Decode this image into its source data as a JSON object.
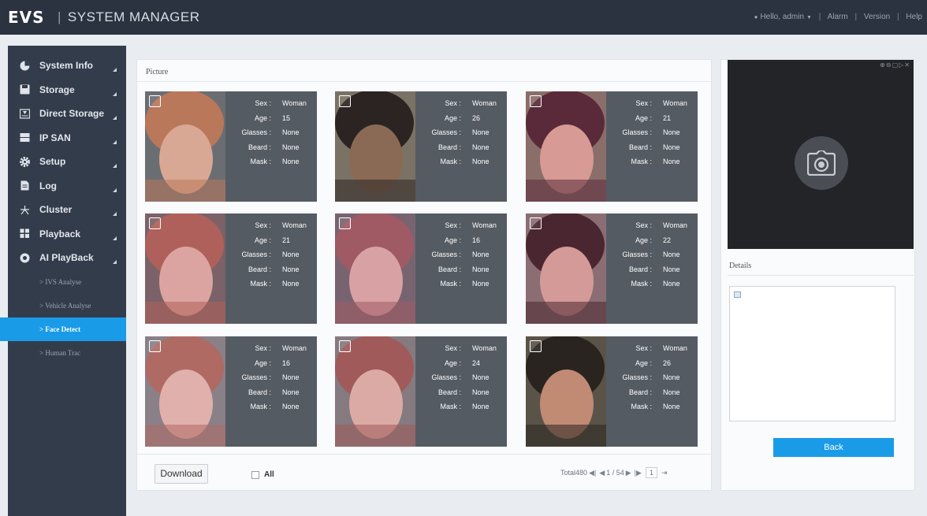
{
  "header": {
    "logo": "EVS",
    "title": "SYSTEM MANAGER",
    "user": "Hello, admin",
    "links": [
      "Alarm",
      "Version",
      "Help"
    ]
  },
  "sidebar": {
    "items": [
      {
        "label": "System Info",
        "icon": "pie-chart-icon"
      },
      {
        "label": "Storage",
        "icon": "save-icon"
      },
      {
        "label": "Direct Storage",
        "icon": "disk-icon"
      },
      {
        "label": "IP SAN",
        "icon": "server-icon"
      },
      {
        "label": "Setup",
        "icon": "gear-icon"
      },
      {
        "label": "Log",
        "icon": "document-icon"
      },
      {
        "label": "Cluster",
        "icon": "cluster-icon"
      },
      {
        "label": "Playback",
        "icon": "film-icon"
      },
      {
        "label": "AI PlayBack",
        "icon": "ai-icon"
      }
    ],
    "subitems": [
      {
        "label": "> IVS Analyse",
        "active": false
      },
      {
        "label": "> Vehicle Analyse",
        "active": false
      },
      {
        "label": "> Face Detect",
        "active": true
      },
      {
        "label": "> Human Trac",
        "active": false
      }
    ]
  },
  "main": {
    "section_label": "Picture",
    "attr_labels": {
      "sex": "Sex :",
      "age": "Age :",
      "glasses": "Glasses :",
      "beard": "Beard :",
      "mask": "Mask :"
    },
    "cards": [
      {
        "sex": "Woman",
        "age": "15",
        "glasses": "None",
        "beard": "None",
        "mask": "None",
        "hair": "#b9785a",
        "skin": "#d9a894",
        "bg": "#6a6e72"
      },
      {
        "sex": "Woman",
        "age": "26",
        "glasses": "None",
        "beard": "None",
        "mask": "None",
        "hair": "#2b2422",
        "skin": "#8a6a55",
        "bg": "#7a7264"
      },
      {
        "sex": "Woman",
        "age": "21",
        "glasses": "None",
        "beard": "None",
        "mask": "None",
        "hair": "#5a2a3a",
        "skin": "#d79a94",
        "bg": "#8a6e6a"
      },
      {
        "sex": "Woman",
        "age": "21",
        "glasses": "None",
        "beard": "None",
        "mask": "None",
        "hair": "#b0605a",
        "skin": "#dca4a0",
        "bg": "#7a6268"
      },
      {
        "sex": "Woman",
        "age": "16",
        "glasses": "None",
        "beard": "None",
        "mask": "None",
        "hair": "#a05a64",
        "skin": "#d8a2a4",
        "bg": "#786470"
      },
      {
        "sex": "Woman",
        "age": "22",
        "glasses": "None",
        "beard": "None",
        "mask": "None",
        "hair": "#4a2630",
        "skin": "#d49a98",
        "bg": "#8a6e74"
      },
      {
        "sex": "Woman",
        "age": "16",
        "glasses": "None",
        "beard": "None",
        "mask": "None",
        "hair": "#b06a64",
        "skin": "#e0b0ac",
        "bg": "#8a8088"
      },
      {
        "sex": "Woman",
        "age": "24",
        "glasses": "None",
        "beard": "None",
        "mask": "None",
        "hair": "#a05a5a",
        "skin": "#dcaaa4",
        "bg": "#847a80"
      },
      {
        "sex": "Woman",
        "age": "26",
        "glasses": "None",
        "beard": "None",
        "mask": "None",
        "hair": "#2a2420",
        "skin": "#c08a74",
        "bg": "#5a5448"
      }
    ],
    "download_label": "Download",
    "all_label": "All",
    "pager": {
      "total": "Total480",
      "page_text": "1 / 54",
      "page_input": "1"
    }
  },
  "right": {
    "viewer_tools": "⊕⊖▢▷✕",
    "details_label": "Details",
    "back_label": "Back"
  },
  "colors": {
    "topbar": "#2b3341",
    "sidebar": "#333c4a",
    "accent": "#1a9be8",
    "card_bg": "#555b63"
  }
}
